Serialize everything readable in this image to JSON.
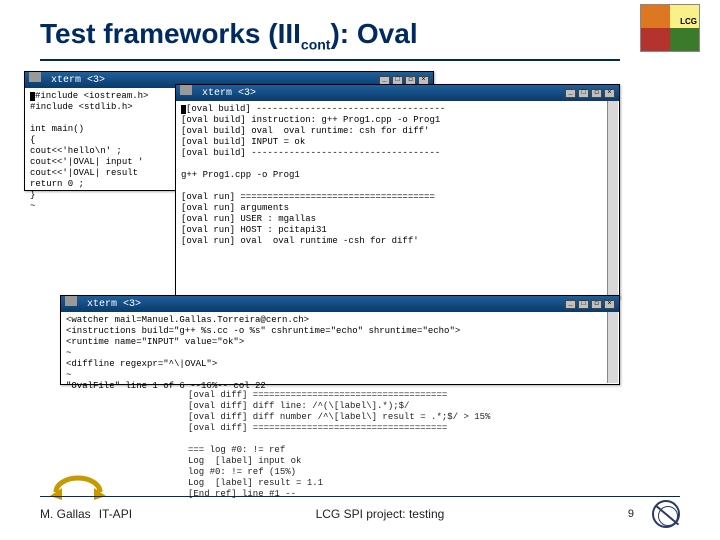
{
  "header": {
    "title_pre": "Test frameworks (III",
    "title_sub": "cont",
    "title_post": "): Oval"
  },
  "lcg": {
    "label": "LCG"
  },
  "xterm": {
    "title": "xterm <3>",
    "btn_min": "_",
    "btn_max": "□",
    "btn_big": "◻",
    "btn_close": "×"
  },
  "win1": {
    "lines": "#include <iostream.h>\n#include <stdlib.h>\n\nint main()\n{\ncout<<'hello\\n' ;\ncout<<'|OVAL| input '\ncout<<'|OVAL| result\nreturn 0 ;\n}\n~"
  },
  "win2": {
    "lines": "[oval build] -----------------------------------\n[oval build] instruction: g++ Prog1.cpp -o Prog1\n[oval build] oval  oval runtime: csh for diff'\n[oval build] INPUT = ok\n[oval build] -----------------------------------\n\ng++ Prog1.cpp -o Prog1\n\n[oval run] ====================================\n[oval run] arguments\n[oval run] USER : mgallas\n[oval run] HOST : pcitapi31\n[oval run] oval  oval runtime -csh for diff'"
  },
  "win3": {
    "lines": "<watcher mail=Manuel.Gallas.Torreira@cern.ch>\n<instructions build=\"g++ %s.cc -o %s\" cshruntime=\"echo\" shruntime=\"echo\">\n<runtime name=\"INPUT\" value=\"ok\">\n~\n<diffline regexpr=\"^\\|OVAL\">\n~\n\"OvalFile\" line 1 of 6 --16%-- col 22"
  },
  "plain1": "[oval diff] ====================================\n[oval diff] diff line: /^(\\[label\\].*);$/\n[oval diff] diff number /^\\[label\\] result = .*;$/ > 15%\n[oval diff] ====================================\n\n=== log #0: != ref\nLog  [label] input ok\nlog #0: != ref (15%)\nLog  [label] result = 1.1\n[End ref] line #1 --",
  "footer": {
    "author": "M. Gallas",
    "group": "IT-API",
    "center": "LCG SPI project: testing",
    "page": "9"
  }
}
